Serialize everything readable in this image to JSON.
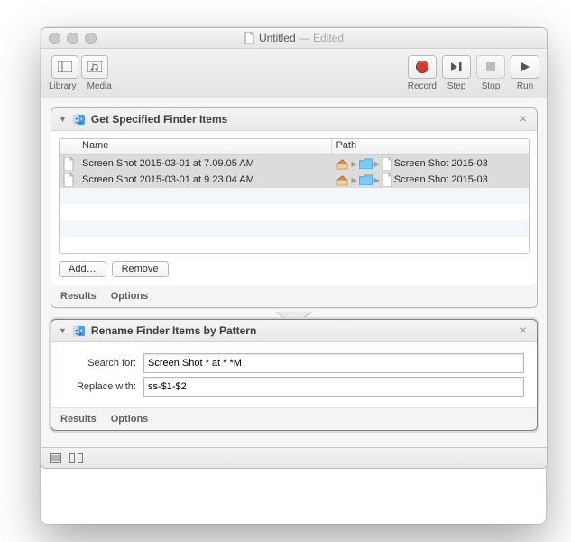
{
  "window": {
    "title": "Untitled",
    "edited_label": "— Edited"
  },
  "toolbar": {
    "library_label": "Library",
    "media_label": "Media",
    "record_label": "Record",
    "step_label": "Step",
    "stop_label": "Stop",
    "run_label": "Run"
  },
  "action1": {
    "title": "Get Specified Finder Items",
    "col_name": "Name",
    "col_path": "Path",
    "rows": [
      {
        "name": "Screen Shot 2015-03-01 at 7.09.05 AM",
        "path_tail": "Screen Shot 2015-03"
      },
      {
        "name": "Screen Shot 2015-03-01 at 9.23.04 AM",
        "path_tail": "Screen Shot 2015-03"
      }
    ],
    "add_label": "Add…",
    "remove_label": "Remove",
    "results_label": "Results",
    "options_label": "Options"
  },
  "action2": {
    "title": "Rename Finder Items by Pattern",
    "search_label": "Search for:",
    "replace_label": "Replace with:",
    "search_value": "Screen Shot * at * *M",
    "replace_value": "ss-$1-$2",
    "results_label": "Results",
    "options_label": "Options"
  }
}
